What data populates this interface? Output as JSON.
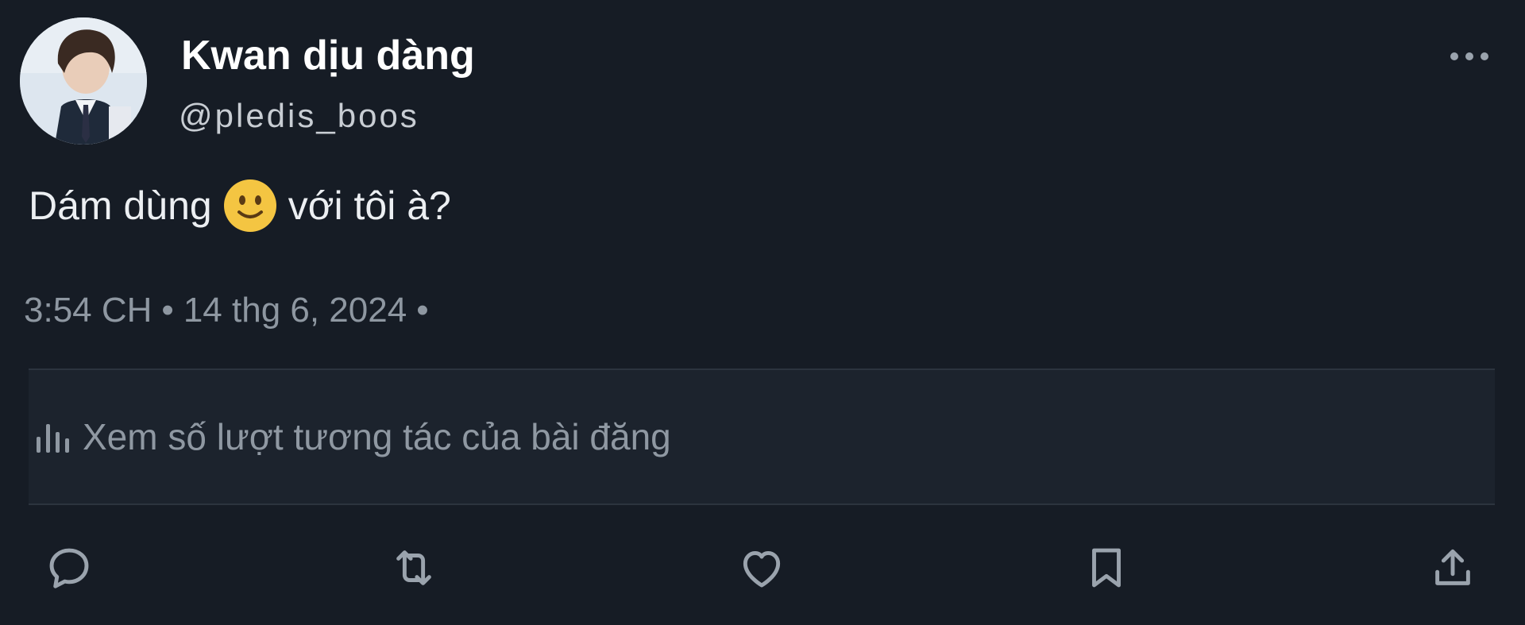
{
  "author": {
    "display_name": "Kwan dịu dàng",
    "handle": "@pledis_boos"
  },
  "post": {
    "text_before_emoji": "Dám dùng",
    "emoji": "slightly-smiling-face-emoji",
    "text_after_emoji": "với tôi à?"
  },
  "meta": {
    "time": "3:54 CH",
    "separator": "•",
    "date": "14 thg 6, 2024"
  },
  "engagement": {
    "icon": "analytics-bars-icon",
    "label": "Xem số lượt tương tác của bài đăng"
  },
  "actions": [
    "reply-icon",
    "repost-icon",
    "like-icon",
    "bookmark-icon",
    "share-icon"
  ],
  "colors": {
    "background": "#161c25",
    "engagement_bg": "#1c232d",
    "muted_text": "#8e97a1",
    "icon": "#9aa3ad",
    "emoji_yellow": "#f4c542"
  }
}
